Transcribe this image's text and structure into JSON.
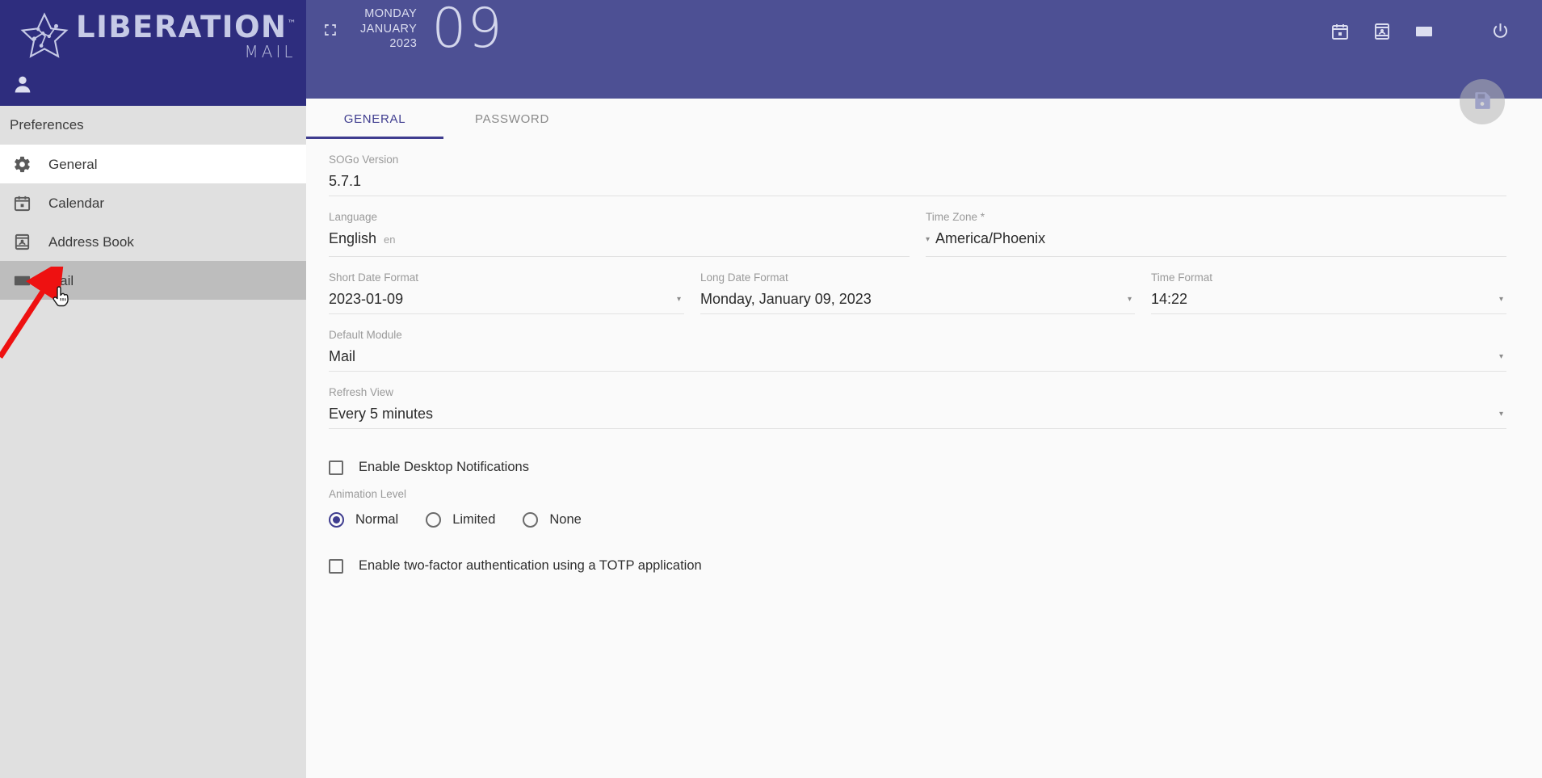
{
  "brand": {
    "name": "LIBERATION",
    "tm": "™",
    "product": "MAIL",
    "star_icon": "star-logo-icon",
    "avatar_icon": "user-avatar-icon"
  },
  "topbar": {
    "expand_icon": "expand-fullscreen-icon",
    "date": {
      "weekday": "MONDAY",
      "month": "JANUARY",
      "year": "2023",
      "day": "09"
    },
    "icons": [
      {
        "name": "calendar-icon",
        "label": "Calendar"
      },
      {
        "name": "address-book-icon",
        "label": "Address Book"
      },
      {
        "name": "mail-icon",
        "label": "Mail"
      },
      {
        "name": "power-icon",
        "label": "Sign Out"
      }
    ],
    "bg_color": "#4d5094",
    "brand_bg_color": "#2e2d7e"
  },
  "sidebar": {
    "title": "Preferences",
    "items": [
      {
        "label": "General",
        "icon": "gear-icon",
        "state": "active"
      },
      {
        "label": "Calendar",
        "icon": "calendar-icon",
        "state": "normal"
      },
      {
        "label": "Address Book",
        "icon": "address-book-icon",
        "state": "normal"
      },
      {
        "label": "Mail",
        "icon": "mail-icon",
        "state": "hover"
      }
    ]
  },
  "tabs": [
    {
      "label": "GENERAL",
      "active": true
    },
    {
      "label": "PASSWORD",
      "active": false
    }
  ],
  "fab": {
    "icon": "save-floppy-icon",
    "enabled": false
  },
  "form": {
    "sogo_version": {
      "label": "SOGo Version",
      "value": "5.7.1"
    },
    "language": {
      "label": "Language",
      "value": "English",
      "suffix": "en"
    },
    "time_zone": {
      "label": "Time Zone",
      "required": "*",
      "value": "America/Phoenix"
    },
    "short_date_format": {
      "label": "Short Date Format",
      "value": "2023-01-09"
    },
    "long_date_format": {
      "label": "Long Date Format",
      "value": "Monday, January 09, 2023"
    },
    "time_format": {
      "label": "Time Format",
      "value": "14:22"
    },
    "default_module": {
      "label": "Default Module",
      "value": "Mail"
    },
    "refresh_view": {
      "label": "Refresh View",
      "value": "Every 5 minutes"
    },
    "desktop_notifications": {
      "label": "Enable Desktop Notifications",
      "checked": false
    },
    "animation_level": {
      "label": "Animation Level",
      "options": [
        {
          "label": "Normal",
          "selected": true
        },
        {
          "label": "Limited",
          "selected": false
        },
        {
          "label": "None",
          "selected": false
        }
      ]
    },
    "two_factor": {
      "label": "Enable two-factor authentication using a TOTP application",
      "checked": false
    }
  },
  "annotation": {
    "arrow_color": "#ee1111",
    "arrow_target": "sidebar-item-mail",
    "cursor": "pointer-hand-cursor"
  },
  "colors": {
    "accent": "#3f3d8f",
    "header": "#4d5094",
    "brand_header": "#2e2d7e",
    "sidebar_bg": "#e0e0e0",
    "content_bg": "#fafafa"
  }
}
